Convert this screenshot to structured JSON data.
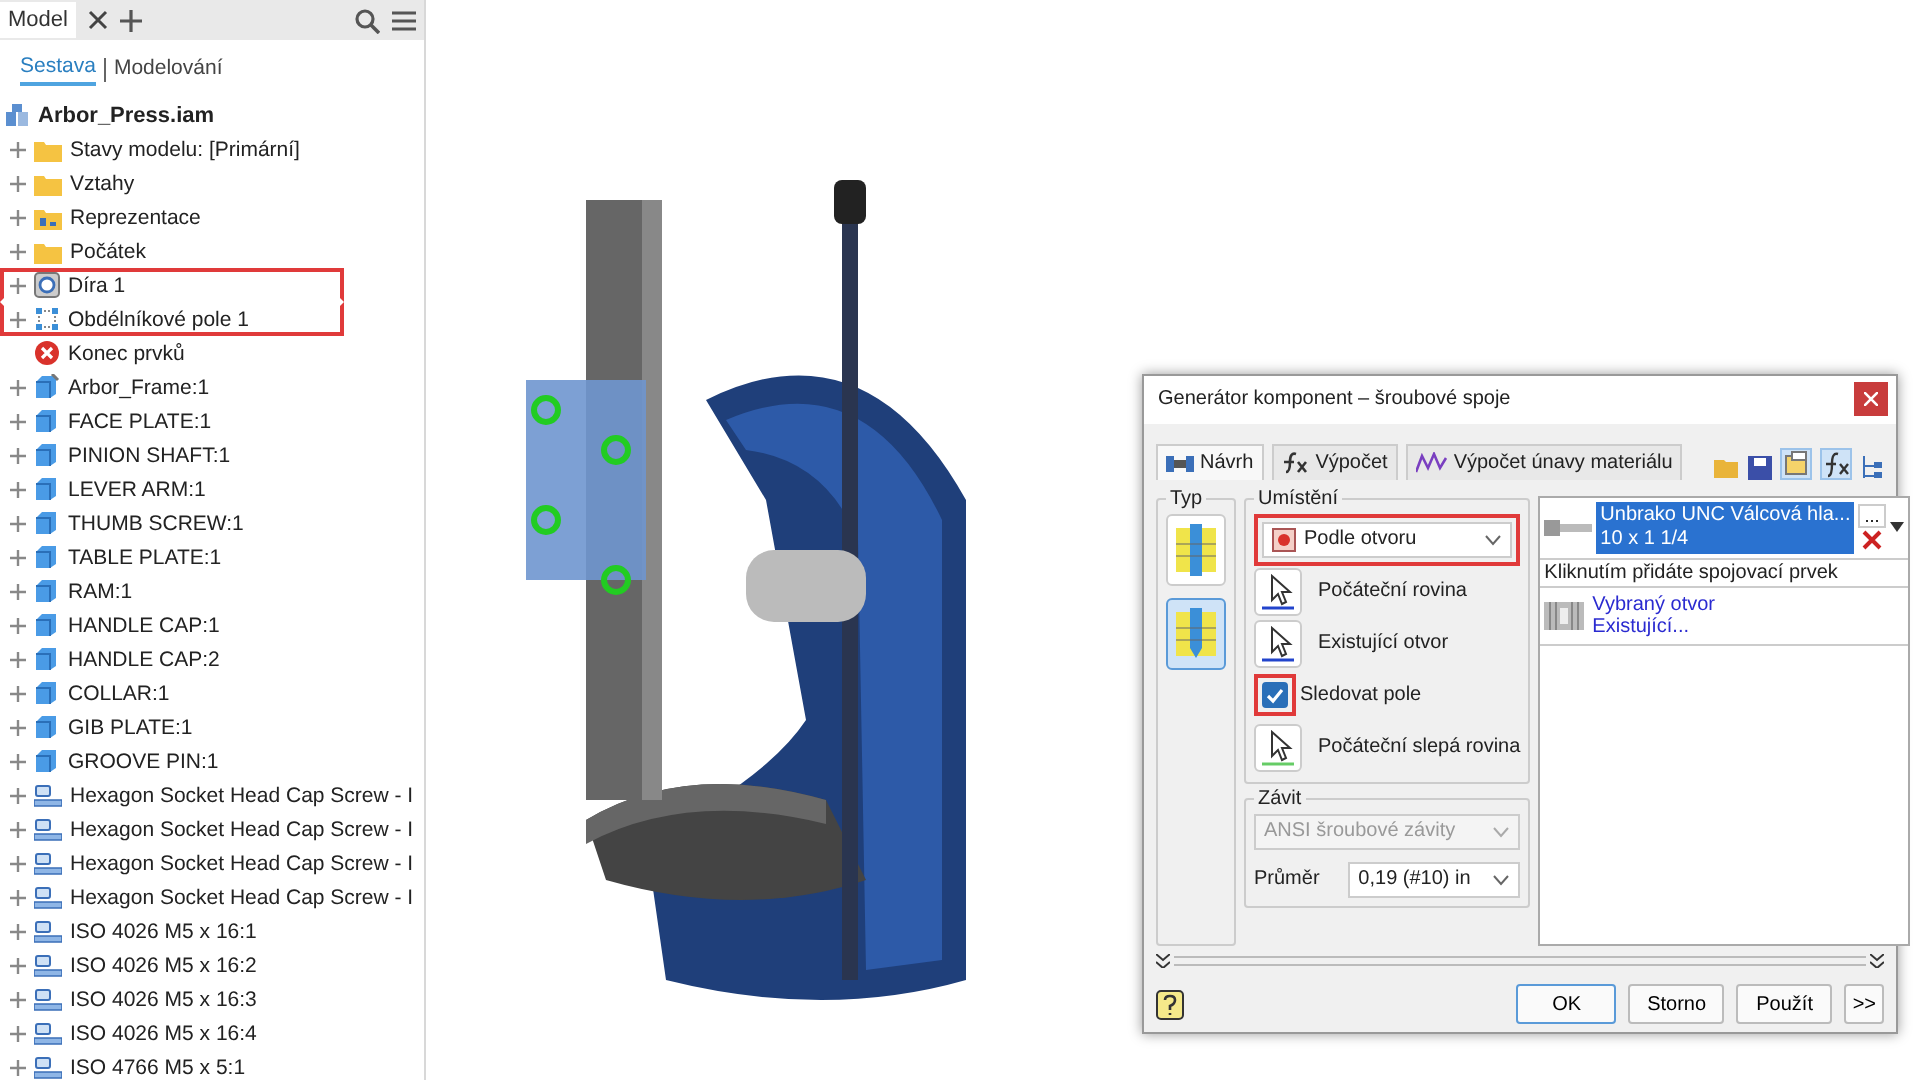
{
  "browser": {
    "tabs": [
      {
        "label": "Model",
        "selected": true
      }
    ],
    "subtabs": [
      {
        "label": "Sestava",
        "selected": true
      },
      {
        "label": "Modelování",
        "selected": false
      }
    ],
    "root": "Arbor_Press.iam",
    "items": [
      {
        "label": "Stavy modelu: [Primární]",
        "kind": "folder",
        "expandable": true,
        "highlighted": false
      },
      {
        "label": "Vztahy",
        "kind": "folder",
        "expandable": true,
        "highlighted": false
      },
      {
        "label": "Reprezentace",
        "kind": "representation",
        "expandable": true,
        "highlighted": false
      },
      {
        "label": "Počátek",
        "kind": "folder",
        "expandable": true,
        "highlighted": false
      },
      {
        "label": "Díra 1",
        "kind": "hole",
        "expandable": true,
        "highlighted": true
      },
      {
        "label": "Obdélníkové pole 1",
        "kind": "pattern",
        "expandable": true,
        "highlighted": true
      },
      {
        "label": "Konec prvků",
        "kind": "end",
        "expandable": false,
        "highlighted": false
      },
      {
        "label": "Arbor_Frame:1",
        "kind": "frame",
        "expandable": true,
        "highlighted": false
      },
      {
        "label": "FACE PLATE:1",
        "kind": "part",
        "expandable": true,
        "highlighted": false
      },
      {
        "label": "PINION SHAFT:1",
        "kind": "part",
        "expandable": true,
        "highlighted": false
      },
      {
        "label": "LEVER ARM:1",
        "kind": "part",
        "expandable": true,
        "highlighted": false
      },
      {
        "label": "THUMB SCREW:1",
        "kind": "part",
        "expandable": true,
        "highlighted": false
      },
      {
        "label": "TABLE PLATE:1",
        "kind": "part",
        "expandable": true,
        "highlighted": false
      },
      {
        "label": "RAM:1",
        "kind": "part",
        "expandable": true,
        "highlighted": false
      },
      {
        "label": "HANDLE CAP:1",
        "kind": "part",
        "expandable": true,
        "highlighted": false
      },
      {
        "label": "HANDLE CAP:2",
        "kind": "part",
        "expandable": true,
        "highlighted": false
      },
      {
        "label": "COLLAR:1",
        "kind": "part",
        "expandable": true,
        "highlighted": false
      },
      {
        "label": "GIB PLATE:1",
        "kind": "part",
        "expandable": true,
        "highlighted": false
      },
      {
        "label": "GROOVE PIN:1",
        "kind": "part",
        "expandable": true,
        "highlighted": false
      },
      {
        "label": "Hexagon Socket Head Cap Screw - I",
        "kind": "fastener",
        "expandable": true,
        "highlighted": false
      },
      {
        "label": "Hexagon Socket Head Cap Screw - I",
        "kind": "fastener",
        "expandable": true,
        "highlighted": false
      },
      {
        "label": "Hexagon Socket Head Cap Screw - I",
        "kind": "fastener",
        "expandable": true,
        "highlighted": false
      },
      {
        "label": "Hexagon Socket Head Cap Screw - I",
        "kind": "fastener",
        "expandable": true,
        "highlighted": false
      },
      {
        "label": "ISO 4026 M5 x 16:1",
        "kind": "fastener",
        "expandable": true,
        "highlighted": false
      },
      {
        "label": "ISO 4026 M5 x 16:2",
        "kind": "fastener",
        "expandable": true,
        "highlighted": false
      },
      {
        "label": "ISO 4026 M5 x 16:3",
        "kind": "fastener",
        "expandable": true,
        "highlighted": false
      },
      {
        "label": "ISO 4026 M5 x 16:4",
        "kind": "fastener",
        "expandable": true,
        "highlighted": false
      },
      {
        "label": "ISO 4766 M5 x 5:1",
        "kind": "fastener",
        "expandable": true,
        "highlighted": false
      }
    ]
  },
  "dialog": {
    "title": "Generátor komponent – šroubové spoje",
    "tabs": [
      {
        "label": "Návrh",
        "kind": "design",
        "selected": true
      },
      {
        "label": "Výpočet",
        "kind": "calc",
        "selected": false
      },
      {
        "label": "Výpočet únavy materiálu",
        "kind": "fatigue",
        "selected": false
      }
    ],
    "type_label": "Typ",
    "types": [
      {
        "kind": "through",
        "selected": false
      },
      {
        "kind": "blind",
        "selected": true
      }
    ],
    "placement_label": "Umístění",
    "placement": {
      "value": "Podle otvoru",
      "highlighted": true
    },
    "picks": [
      {
        "label": "Počáteční rovina",
        "kind": "pick"
      },
      {
        "label": "Existující otvor",
        "kind": "pick"
      },
      {
        "label": "Sledovat pole",
        "kind": "check",
        "checked": true,
        "highlighted": true
      },
      {
        "label": "Počáteční slepá rovina",
        "kind": "pick"
      }
    ],
    "thread_label": "Závit",
    "thread": {
      "value": "ANSI šroubové závity",
      "disabled": true
    },
    "diameter_label": "Průměr",
    "diameter": "0,19 (#10) in",
    "fastener": {
      "name": "Unbrako UNC Válcová hla...",
      "size": "10 x 1 1/4",
      "more": "..."
    },
    "add_hint": "Kliknutím přidáte spojovací prvek",
    "hole_link": "Vybraný otvor",
    "hole_sub": "Existující...",
    "buttons": [
      {
        "label": "OK",
        "kind": "default"
      },
      {
        "label": "Storno",
        "kind": "normal"
      },
      {
        "label": "Použít",
        "kind": "normal"
      },
      {
        "label": ">>",
        "kind": "small"
      }
    ]
  }
}
